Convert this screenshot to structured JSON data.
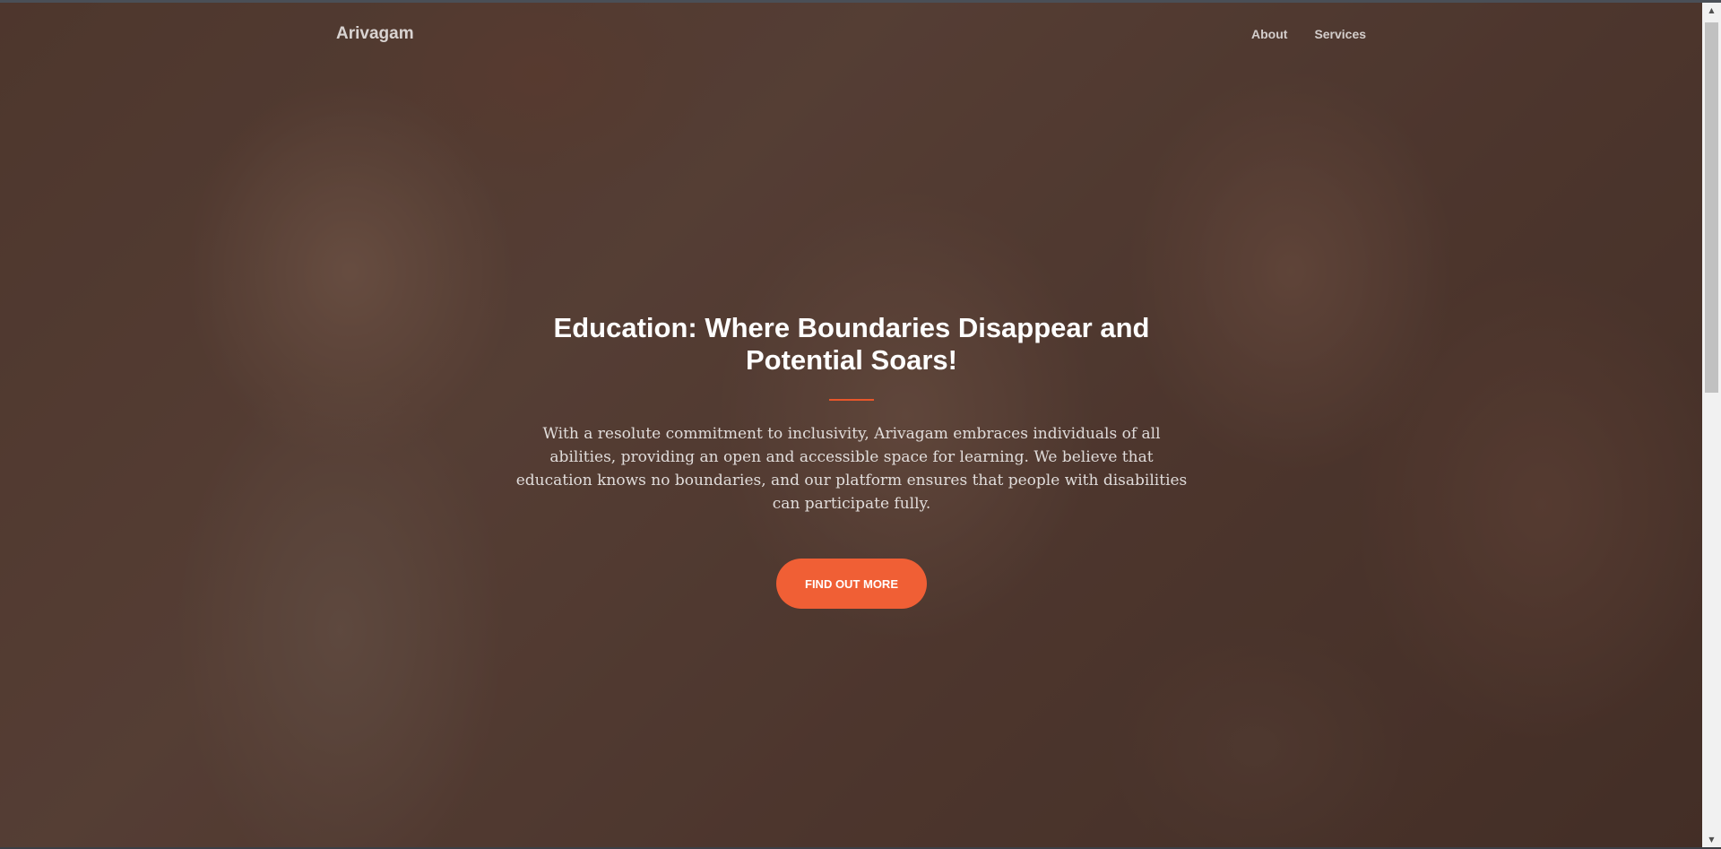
{
  "navbar": {
    "brand": "Arivagam",
    "links": [
      "About",
      "Services"
    ]
  },
  "hero": {
    "title": "Education: Where Boundaries Disappear and Potential Soars!",
    "text": "With a resolute commitment to inclusivity, Arivagam embraces individuals of all abilities, providing an open and accessible space for learning. We believe that education knows no boundaries, and our platform ensures that people with disabilities can participate fully.",
    "button_label": "Find Out More",
    "background_image": "smiling children photo"
  },
  "colors": {
    "accent": "#f05f35",
    "divider": "#e8562a"
  },
  "scrollbar": {
    "up_icon": "triangle-up-icon",
    "down_icon": "triangle-down-icon"
  }
}
